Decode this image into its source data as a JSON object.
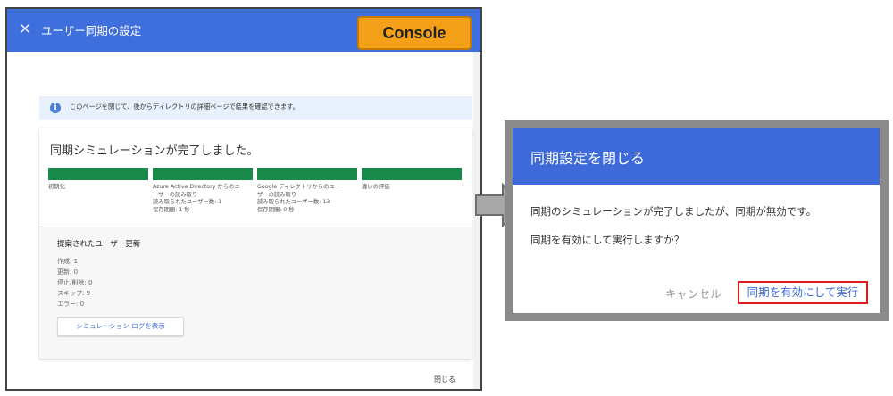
{
  "left_panel": {
    "title": "ユーザー同期の設定",
    "close_icon": "×",
    "badge": "Console",
    "info_icon": "i",
    "info_text": "このページを閉じて、後からディレクトリの詳細ページで結果を確認できます。",
    "simulation": {
      "title": "同期シミュレーションが完了しました。",
      "steps": [
        {
          "lines": [
            "初期化"
          ]
        },
        {
          "lines": [
            "Azure Active Directory からのユ",
            "ーザーの読み取り",
            "読み取られたユーザー数: 1",
            "保存期間: 1 秒"
          ]
        },
        {
          "lines": [
            "Google ディレクトリからのユー",
            "ザーの読み取り",
            "読み取られたユーザー数: 13",
            "保存期間: 0 秒"
          ]
        },
        {
          "lines": [
            "違いの評価"
          ]
        }
      ],
      "proposed_title": "提案されたユーザー更新",
      "counts": [
        "作成: 1",
        "更新: 0",
        "停止/削除: 0",
        "スキップ: 9",
        "エラー: 0"
      ],
      "log_button": "シミュレーション ログを表示"
    },
    "close_link": "閉じる"
  },
  "dialog": {
    "title": "同期設定を閉じる",
    "message1": "同期のシミュレーションが完了しましたが、同期が無効です。",
    "message2": "同期を有効にして実行しますか？",
    "cancel": "キャンセル",
    "confirm": "同期を有効にして実行"
  },
  "colors": {
    "header_blue": "#3f6fdc",
    "progress_green": "#1a8a4a",
    "badge_orange": "#f4a018",
    "highlight_red": "#e0191e"
  }
}
